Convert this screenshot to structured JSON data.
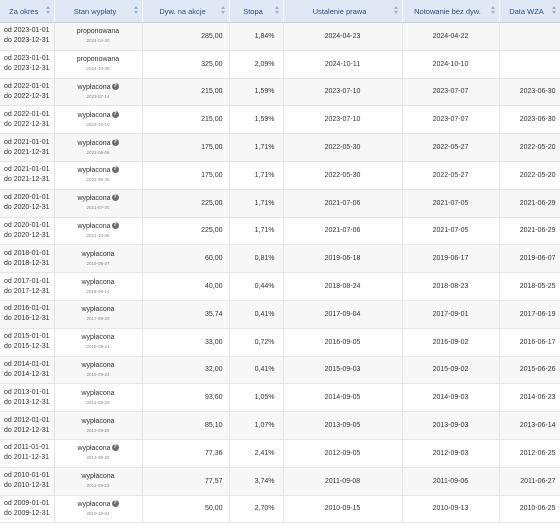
{
  "headers": [
    "Za okres",
    "Stan wypłaty",
    "Dyw. na akcje",
    "Stopa",
    "Ustalenie prawa",
    "Notowanie bez dyw.",
    "Data WZA"
  ],
  "rows": [
    {
      "from": "od 2023-01-01",
      "to": "do 2023-12-31",
      "status": "proponowana",
      "status_date": "2024-04-30",
      "has_info": false,
      "dividend": "285,00",
      "yield": "1,84%",
      "record_date": "2024-04-23",
      "ex_date": "2024-04-22",
      "agm_date": ""
    },
    {
      "from": "od 2023-01-01",
      "to": "do 2023-12-31",
      "status": "proponowana",
      "status_date": "2024-10-30",
      "has_info": false,
      "dividend": "325,00",
      "yield": "2,09%",
      "record_date": "2024-10-11",
      "ex_date": "2024-10-10",
      "agm_date": ""
    },
    {
      "from": "od 2022-01-01",
      "to": "do 2022-12-31",
      "status": "wypłacona",
      "status_date": "2023-07-14",
      "has_info": true,
      "dividend": "215,00",
      "yield": "1,59%",
      "record_date": "2023-07-10",
      "ex_date": "2023-07-07",
      "agm_date": "2023-06-30"
    },
    {
      "from": "od 2022-01-01",
      "to": "do 2022-12-31",
      "status": "wypłacona",
      "status_date": "2023-10-10",
      "has_info": true,
      "dividend": "215,00",
      "yield": "1,59%",
      "record_date": "2023-07-10",
      "ex_date": "2023-07-07",
      "agm_date": "2023-06-30"
    },
    {
      "from": "od 2021-01-01",
      "to": "do 2021-12-31",
      "status": "wypłacona",
      "status_date": "2022-06-06",
      "has_info": true,
      "dividend": "175,00",
      "yield": "1,71%",
      "record_date": "2022-05-30",
      "ex_date": "2022-05-27",
      "agm_date": "2022-05-20"
    },
    {
      "from": "od 2021-01-01",
      "to": "do 2021-12-31",
      "status": "wypłacona",
      "status_date": "2022-08-30",
      "has_info": true,
      "dividend": "175,00",
      "yield": "1,71%",
      "record_date": "2022-05-30",
      "ex_date": "2022-05-27",
      "agm_date": "2022-05-20"
    },
    {
      "from": "od 2020-01-01",
      "to": "do 2020-12-31",
      "status": "wypłacona",
      "status_date": "2021-07-20",
      "has_info": true,
      "dividend": "225,00",
      "yield": "1,71%",
      "record_date": "2021-07-06",
      "ex_date": "2021-07-05",
      "agm_date": "2021-06-29"
    },
    {
      "from": "od 2020-01-01",
      "to": "do 2020-12-31",
      "status": "wypłacona",
      "status_date": "2021-10-06",
      "has_info": true,
      "dividend": "225,00",
      "yield": "1,71%",
      "record_date": "2021-07-06",
      "ex_date": "2021-07-05",
      "agm_date": "2021-06-29"
    },
    {
      "from": "od 2018-01-01",
      "to": "do 2018-12-31",
      "status": "wypłacona",
      "status_date": "2019-06-27",
      "has_info": false,
      "dividend": "60,00",
      "yield": "0,81%",
      "record_date": "2019-06-18",
      "ex_date": "2019-06-17",
      "agm_date": "2019-06-07"
    },
    {
      "from": "od 2017-01-01",
      "to": "do 2017-12-31",
      "status": "wypłacona",
      "status_date": "2018-09-14",
      "has_info": false,
      "dividend": "40,00",
      "yield": "0,44%",
      "record_date": "2018-08-24",
      "ex_date": "2018-08-23",
      "agm_date": "2018-05-25"
    },
    {
      "from": "od 2016-01-01",
      "to": "do 2016-12-31",
      "status": "wypłacona",
      "status_date": "2017-09-20",
      "has_info": false,
      "dividend": "35,74",
      "yield": "0,41%",
      "record_date": "2017-09-04",
      "ex_date": "2017-09-01",
      "agm_date": "2017-06-19"
    },
    {
      "from": "od 2015-01-01",
      "to": "do 2015-12-31",
      "status": "wypłacona",
      "status_date": "2016-09-21",
      "has_info": false,
      "dividend": "33,00",
      "yield": "0,72%",
      "record_date": "2016-09-05",
      "ex_date": "2016-09-02",
      "agm_date": "2016-06-17"
    },
    {
      "from": "od 2014-01-01",
      "to": "do 2014-12-31",
      "status": "wypłacona",
      "status_date": "2015-09-24",
      "has_info": false,
      "dividend": "32,00",
      "yield": "0,41%",
      "record_date": "2015-09-03",
      "ex_date": "2015-09-02",
      "agm_date": "2015-06-26"
    },
    {
      "from": "od 2013-01-01",
      "to": "do 2013-12-31",
      "status": "wypłacona",
      "status_date": "2014-09-25",
      "has_info": false,
      "dividend": "93,60",
      "yield": "1,05%",
      "record_date": "2014-09-05",
      "ex_date": "2014-09-03",
      "agm_date": "2014-06-23"
    },
    {
      "from": "od 2012-01-01",
      "to": "do 2012-12-31",
      "status": "wypłacona",
      "status_date": "2013-09-25",
      "has_info": false,
      "dividend": "85,10",
      "yield": "1,07%",
      "record_date": "2013-09-05",
      "ex_date": "2013-09-03",
      "agm_date": "2013-06-14"
    },
    {
      "from": "od 2011-01-01",
      "to": "do 2011-12-31",
      "status": "wypłacona",
      "status_date": "2012-09-25",
      "has_info": true,
      "dividend": "77,36",
      "yield": "2,41%",
      "record_date": "2012-09-05",
      "ex_date": "2012-09-03",
      "agm_date": "2012-06-25"
    },
    {
      "from": "od 2010-01-01",
      "to": "do 2010-12-31",
      "status": "wypłacona",
      "status_date": "2011-09-23",
      "has_info": false,
      "dividend": "77,57",
      "yield": "3,74%",
      "record_date": "2011-09-08",
      "ex_date": "2011-09-06",
      "agm_date": "2011-06-27"
    },
    {
      "from": "od 2009-01-01",
      "to": "do 2009-12-31",
      "status": "wypłacona",
      "status_date": "2010-10-04",
      "has_info": true,
      "dividend": "50,00",
      "yield": "2,70%",
      "record_date": "2010-09-15",
      "ex_date": "2010-09-13",
      "agm_date": "2010-06-25"
    }
  ],
  "icons": {
    "info": "question-mark-icon",
    "sort": "sort-arrows-icon"
  },
  "colors": {
    "header_bg": "#dfe8f4",
    "header_text": "#2d4f82",
    "row_alt": "#f7f7f7"
  }
}
